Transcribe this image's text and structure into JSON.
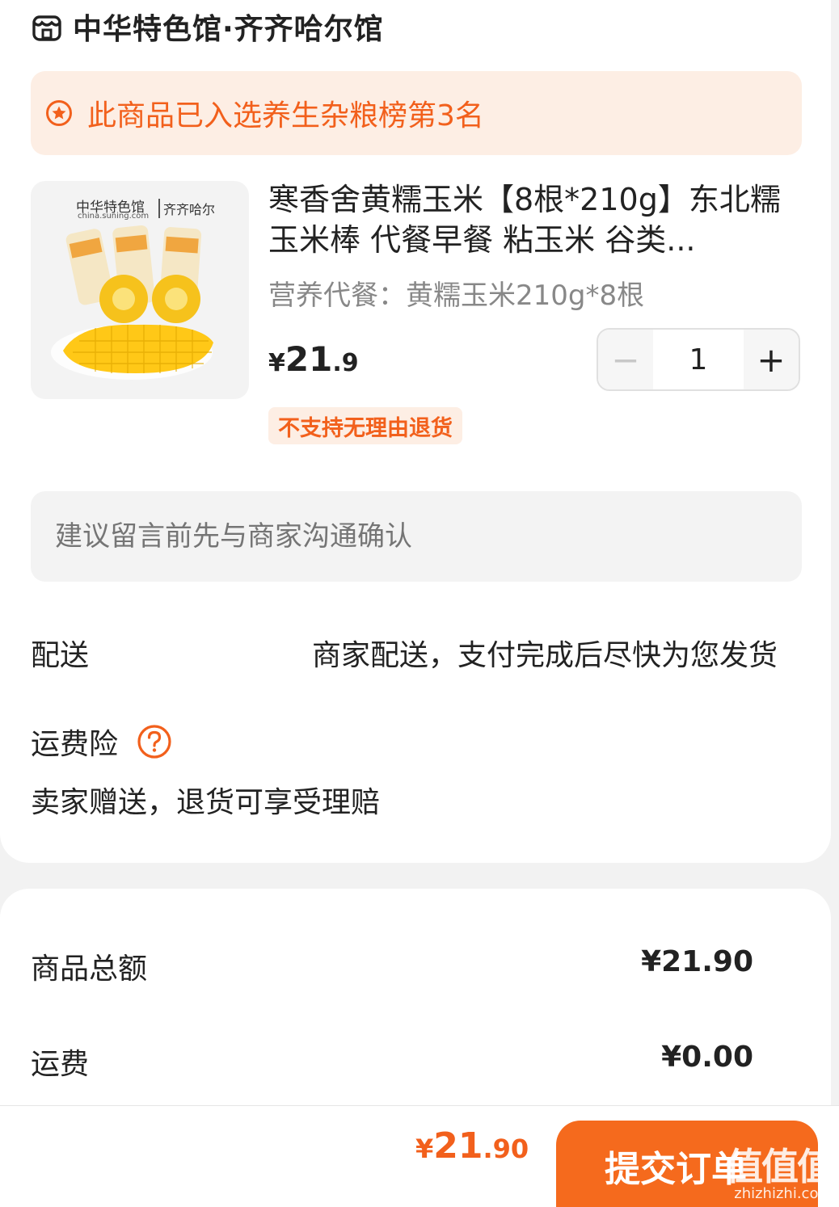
{
  "store": {
    "name": "中华特色馆·齐齐哈尔馆",
    "icon": "store-icon"
  },
  "rank_banner": {
    "text": "此商品已入选养生杂粮榜第3名",
    "icon": "star-badge-icon",
    "color": "#f2601c"
  },
  "product": {
    "image": {
      "brand_text": "中华特色馆",
      "site_text": "china.suning.com",
      "tag_text": "齐齐哈尔"
    },
    "title": "寒香舍黄糯玉米【8根*210g】东北糯玉米棒 代餐早餐 粘玉米 谷类...",
    "spec": "营养代餐：黄糯玉米210g*8根",
    "price": {
      "yen": "¥",
      "int": "21",
      "dec": ".9"
    },
    "quantity": "1",
    "minus_label": "−",
    "plus_label": "+",
    "no_return_tag": "不支持无理由退货"
  },
  "message": {
    "placeholder": "建议留言前先与商家沟通确认"
  },
  "delivery": {
    "label": "配送",
    "value": "商家配送，支付完成后尽快为您发货"
  },
  "insurance": {
    "label": "运费险",
    "description": "卖家赠送，退货可享受理赔",
    "icon": "help-icon"
  },
  "summary": {
    "goods_total_label": "商品总额",
    "goods_total_value": "¥21.90",
    "shipping_label": "运费",
    "shipping_value": "¥0.00"
  },
  "footer": {
    "total": {
      "yen": "¥",
      "int": "21",
      "dec": ".90"
    },
    "submit_label": "提交订单",
    "watermark_main": "值值值",
    "watermark_sub": "zhizhizhi.com"
  },
  "colors": {
    "accent": "#f56a1d",
    "accent_text": "#f2601c",
    "banner_bg": "#fdeee4"
  }
}
